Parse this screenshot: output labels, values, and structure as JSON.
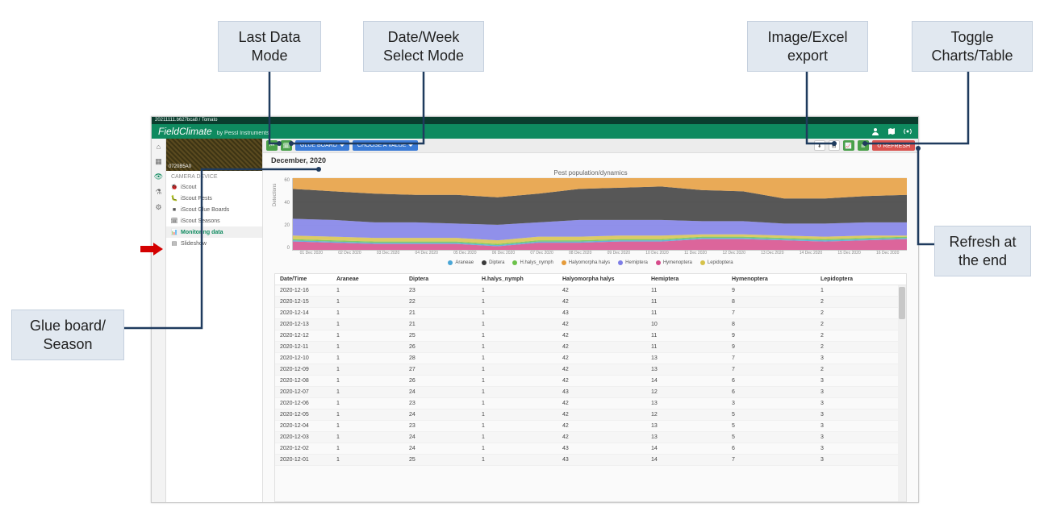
{
  "callouts": {
    "last_data_mode": "Last Data\nMode",
    "date_week": "Date/Week\nSelect Mode",
    "export": "Image/Excel\nexport",
    "toggle": "Toggle\nCharts/Table",
    "refresh_end": "Refresh at\nthe end",
    "glue_season": "Glue board/\nSeason"
  },
  "breadcrumb": "20211111.b627bca8 / Tomato",
  "brand": {
    "name": "FieldClimate",
    "by": "by Pessl Instruments"
  },
  "top_icons": [
    "user-icon",
    "map-icon",
    "broadcast-icon"
  ],
  "iconrail": [
    {
      "name": "home-icon",
      "glyph": "⌂"
    },
    {
      "name": "dashboard-icon",
      "glyph": "▦"
    },
    {
      "name": "eye-icon",
      "glyph": "👁",
      "active": true
    },
    {
      "name": "science-icon",
      "glyph": "⚗"
    },
    {
      "name": "settings-icon",
      "glyph": "⚙"
    }
  ],
  "device_id": "0720B5A0",
  "side_header": "CAMERA DEVICE",
  "side_items": [
    {
      "icon": "🐞",
      "label": "iScout"
    },
    {
      "icon": "🐛",
      "label": "iScout Pests"
    },
    {
      "icon": "■",
      "label": "iScout Glue Boards"
    },
    {
      "icon": "🗓",
      "label": "iScout Seasons"
    },
    {
      "icon": "📊",
      "label": "Monitoring data",
      "active": true
    },
    {
      "icon": "▤",
      "label": "Slideshow"
    }
  ],
  "toolbar": {
    "back_glyph": "⏮",
    "calendar_glyph": "🗓",
    "glue_board": "GLUE BOARD",
    "choose_value": "CHOOSE A VALUE",
    "download_glyph": "⬇",
    "excel_glyph": "⊞",
    "chart_glyph": "📈",
    "table_glyph": "≣",
    "refresh": "↻ REFRESH"
  },
  "month_label": "December, 2020",
  "chart_data": {
    "type": "area",
    "title": "Pest population/dynamics",
    "ylabel": "Detections",
    "ylim": [
      0,
      60
    ],
    "yticks": [
      0,
      20,
      40,
      60
    ],
    "x": [
      "01 Dec 2020",
      "02 Dec 2020",
      "03 Dec 2020",
      "04 Dec 2020",
      "05 Dec 2020",
      "06 Dec 2020",
      "07 Dec 2020",
      "08 Dec 2020",
      "09 Dec 2020",
      "10 Dec 2020",
      "11 Dec 2020",
      "12 Dec 2020",
      "13 Dec 2020",
      "14 Dec 2020",
      "15 Dec 2020",
      "16 Dec 2020"
    ],
    "series": [
      {
        "name": "Araneae",
        "color": "#4aa6d6",
        "values": [
          1,
          1,
          1,
          1,
          1,
          1,
          1,
          1,
          1,
          1,
          1,
          1,
          1,
          1,
          1,
          1
        ]
      },
      {
        "name": "Diptera",
        "color": "#3a3a3a",
        "values": [
          25,
          24,
          24,
          23,
          24,
          23,
          24,
          26,
          27,
          28,
          26,
          25,
          21,
          21,
          22,
          23
        ]
      },
      {
        "name": "H.halys_nymph",
        "color": "#6cc24a",
        "values": [
          1,
          1,
          1,
          1,
          1,
          1,
          1,
          1,
          1,
          1,
          1,
          1,
          1,
          1,
          1,
          1
        ]
      },
      {
        "name": "Halyomorpha halys",
        "color": "#e59b3a",
        "values": [
          43,
          43,
          43,
          42,
          42,
          42,
          43,
          42,
          42,
          42,
          42,
          42,
          42,
          43,
          42,
          42
        ]
      },
      {
        "name": "Hemiptera",
        "color": "#7d7de6",
        "values": [
          14,
          14,
          13,
          13,
          12,
          13,
          12,
          14,
          13,
          13,
          11,
          11,
          10,
          11,
          11,
          11
        ]
      },
      {
        "name": "Hymenoptera",
        "color": "#d64a8a",
        "values": [
          7,
          6,
          5,
          5,
          5,
          3,
          6,
          6,
          7,
          7,
          9,
          9,
          8,
          7,
          8,
          9
        ]
      },
      {
        "name": "Lepidoptera",
        "color": "#d6c24a",
        "values": [
          3,
          3,
          3,
          3,
          3,
          3,
          3,
          3,
          3,
          3,
          2,
          2,
          2,
          2,
          2,
          1
        ]
      }
    ]
  },
  "table": {
    "headers": [
      "Date/Time",
      "Araneae",
      "Diptera",
      "H.halys_nymph",
      "Halyomorpha halys",
      "Hemiptera",
      "Hymenoptera",
      "Lepidoptera"
    ],
    "rows": [
      [
        "2020-12-16",
        "1",
        "23",
        "1",
        "42",
        "11",
        "9",
        "1"
      ],
      [
        "2020-12-15",
        "1",
        "22",
        "1",
        "42",
        "11",
        "8",
        "2"
      ],
      [
        "2020-12-14",
        "1",
        "21",
        "1",
        "43",
        "11",
        "7",
        "2"
      ],
      [
        "2020-12-13",
        "1",
        "21",
        "1",
        "42",
        "10",
        "8",
        "2"
      ],
      [
        "2020-12-12",
        "1",
        "25",
        "1",
        "42",
        "11",
        "9",
        "2"
      ],
      [
        "2020-12-11",
        "1",
        "26",
        "1",
        "42",
        "11",
        "9",
        "2"
      ],
      [
        "2020-12-10",
        "1",
        "28",
        "1",
        "42",
        "13",
        "7",
        "3"
      ],
      [
        "2020-12-09",
        "1",
        "27",
        "1",
        "42",
        "13",
        "7",
        "2"
      ],
      [
        "2020-12-08",
        "1",
        "26",
        "1",
        "42",
        "14",
        "6",
        "3"
      ],
      [
        "2020-12-07",
        "1",
        "24",
        "1",
        "43",
        "12",
        "6",
        "3"
      ],
      [
        "2020-12-06",
        "1",
        "23",
        "1",
        "42",
        "13",
        "3",
        "3"
      ],
      [
        "2020-12-05",
        "1",
        "24",
        "1",
        "42",
        "12",
        "5",
        "3"
      ],
      [
        "2020-12-04",
        "1",
        "23",
        "1",
        "42",
        "13",
        "5",
        "3"
      ],
      [
        "2020-12-03",
        "1",
        "24",
        "1",
        "42",
        "13",
        "5",
        "3"
      ],
      [
        "2020-12-02",
        "1",
        "24",
        "1",
        "43",
        "14",
        "6",
        "3"
      ],
      [
        "2020-12-01",
        "1",
        "25",
        "1",
        "43",
        "14",
        "7",
        "3"
      ]
    ]
  }
}
